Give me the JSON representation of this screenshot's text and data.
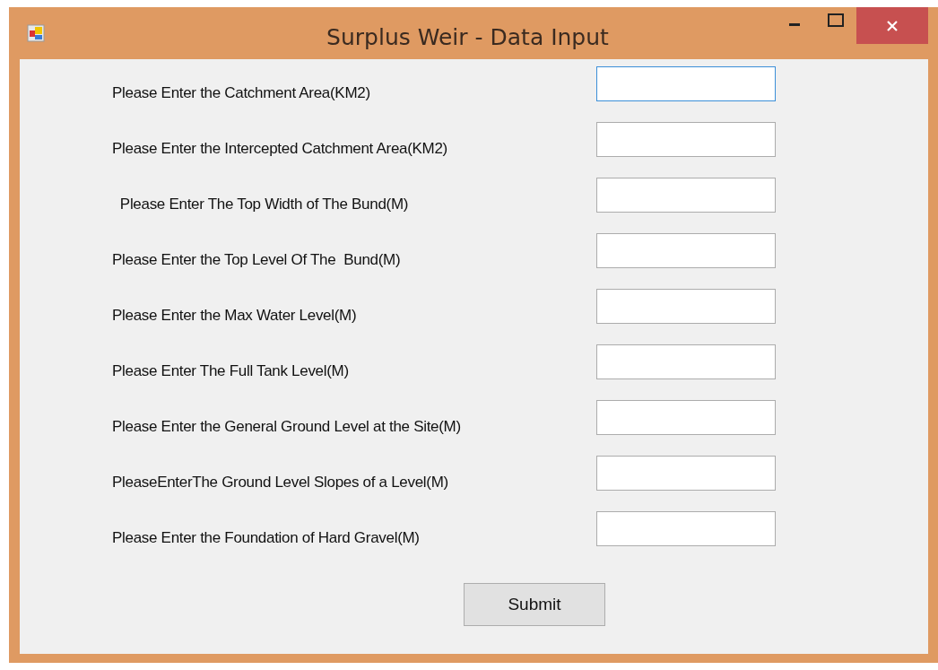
{
  "window": {
    "title": "Surplus Weir - Data Input"
  },
  "fields": [
    {
      "label": "Please Enter the Catchment Area(KM2)",
      "focused": true
    },
    {
      "label": "Please Enter the Intercepted Catchment Area(KM2)",
      "focused": false
    },
    {
      "label": "  Please Enter The Top Width of The Bund(M)",
      "focused": false
    },
    {
      "label": "Please Enter the Top Level Of The  Bund(M)",
      "focused": false
    },
    {
      "label": "Please Enter the Max Water Level(M)",
      "focused": false
    },
    {
      "label": "Please Enter The Full Tank Level(M)",
      "focused": false
    },
    {
      "label": "Please Enter the General Ground Level at the Site(M)",
      "focused": false
    },
    {
      "label": "PleaseEnterThe Ground Level Slopes of a Level(M)",
      "focused": false
    },
    {
      "label": "Please Enter the Foundation of Hard Gravel(M)",
      "focused": false
    }
  ],
  "submit_button": "Submit"
}
